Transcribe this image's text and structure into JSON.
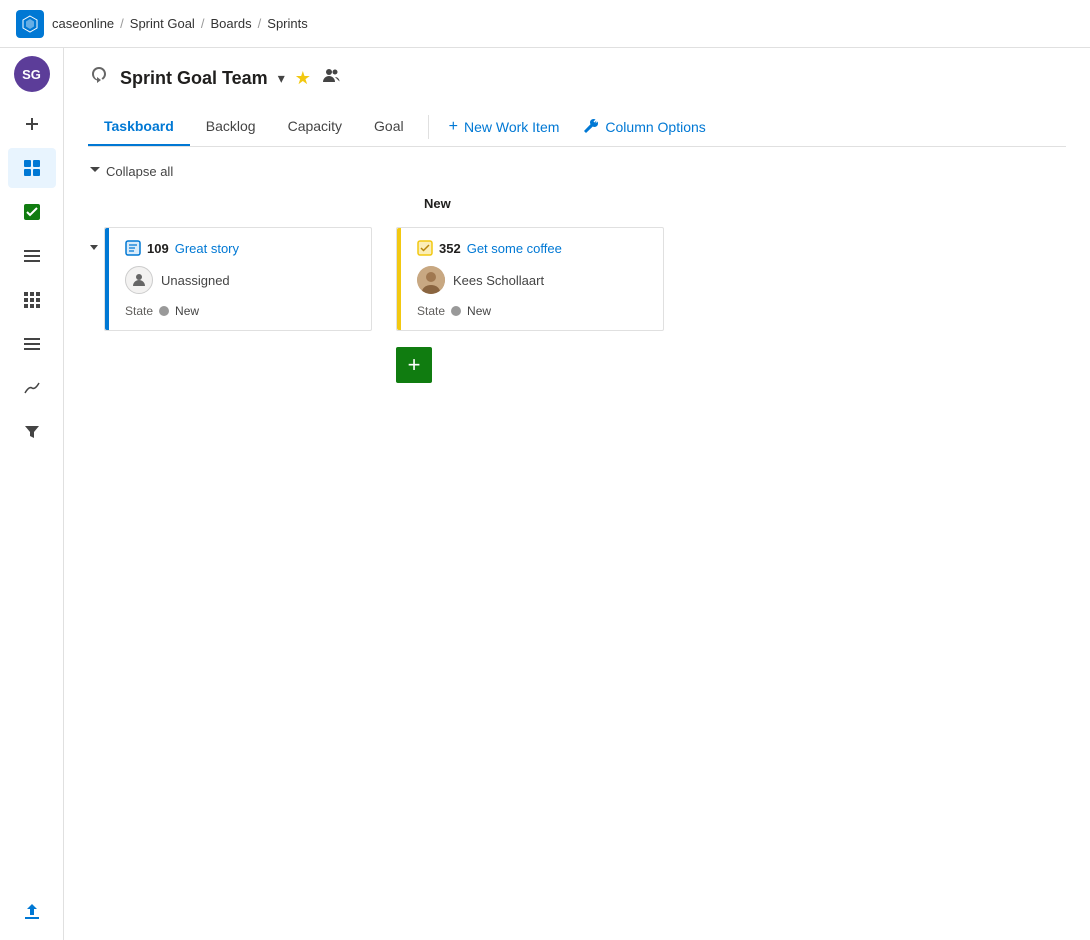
{
  "app": {
    "logo_letter": "⬡",
    "breadcrumb": [
      {
        "label": "caseonline",
        "href": "#"
      },
      {
        "label": "Sprint Goal",
        "href": "#"
      },
      {
        "label": "Boards",
        "href": "#"
      },
      {
        "label": "Sprints",
        "href": "#"
      }
    ]
  },
  "sidebar": {
    "avatar_initials": "SG",
    "items": [
      {
        "id": "add",
        "icon": "+",
        "label": "Add",
        "active": false
      },
      {
        "id": "boards",
        "icon": "▦",
        "label": "Boards",
        "active": true
      },
      {
        "id": "check",
        "icon": "✔",
        "label": "Completed",
        "active": false
      },
      {
        "id": "backlog",
        "icon": "☰",
        "label": "Backlog",
        "active": false
      },
      {
        "id": "grid",
        "icon": "⊞",
        "label": "Grid",
        "active": false
      },
      {
        "id": "layers",
        "icon": "≡",
        "label": "Layers",
        "active": false
      },
      {
        "id": "analytics",
        "icon": "↻",
        "label": "Analytics",
        "active": false
      },
      {
        "id": "filter",
        "icon": "⧖",
        "label": "Filter",
        "active": false
      },
      {
        "id": "deploy",
        "icon": "✈",
        "label": "Deploy",
        "active": false
      }
    ]
  },
  "page": {
    "title": "Sprint Goal Team",
    "title_icon": "↻",
    "tabs": [
      {
        "id": "taskboard",
        "label": "Taskboard",
        "active": true
      },
      {
        "id": "backlog",
        "label": "Backlog",
        "active": false
      },
      {
        "id": "capacity",
        "label": "Capacity",
        "active": false
      },
      {
        "id": "goal",
        "label": "Goal",
        "active": false
      }
    ],
    "actions": [
      {
        "id": "new-work-item",
        "label": "New Work Item",
        "icon": "+"
      },
      {
        "id": "column-options",
        "label": "Column Options",
        "icon": "🔧"
      }
    ]
  },
  "board": {
    "collapse_label": "Collapse all",
    "columns": [
      {
        "id": "empty",
        "label": ""
      },
      {
        "id": "new",
        "label": "New"
      }
    ],
    "stories": [
      {
        "id": "story-1",
        "cards_left": [
          {
            "id": "109",
            "title": "Great story",
            "bar_color": "blue",
            "icon_type": "user-story",
            "assignee": "Unassigned",
            "assignee_type": "unassigned",
            "state_label": "State",
            "state_value": "New",
            "state_color": "#999"
          }
        ],
        "cards_right": [
          {
            "id": "352",
            "title": "Get some coffee",
            "bar_color": "yellow",
            "icon_type": "task",
            "assignee": "Kees Schollaart",
            "assignee_type": "photo",
            "state_label": "State",
            "state_value": "New",
            "state_color": "#999"
          }
        ]
      }
    ],
    "add_button_label": "+"
  }
}
